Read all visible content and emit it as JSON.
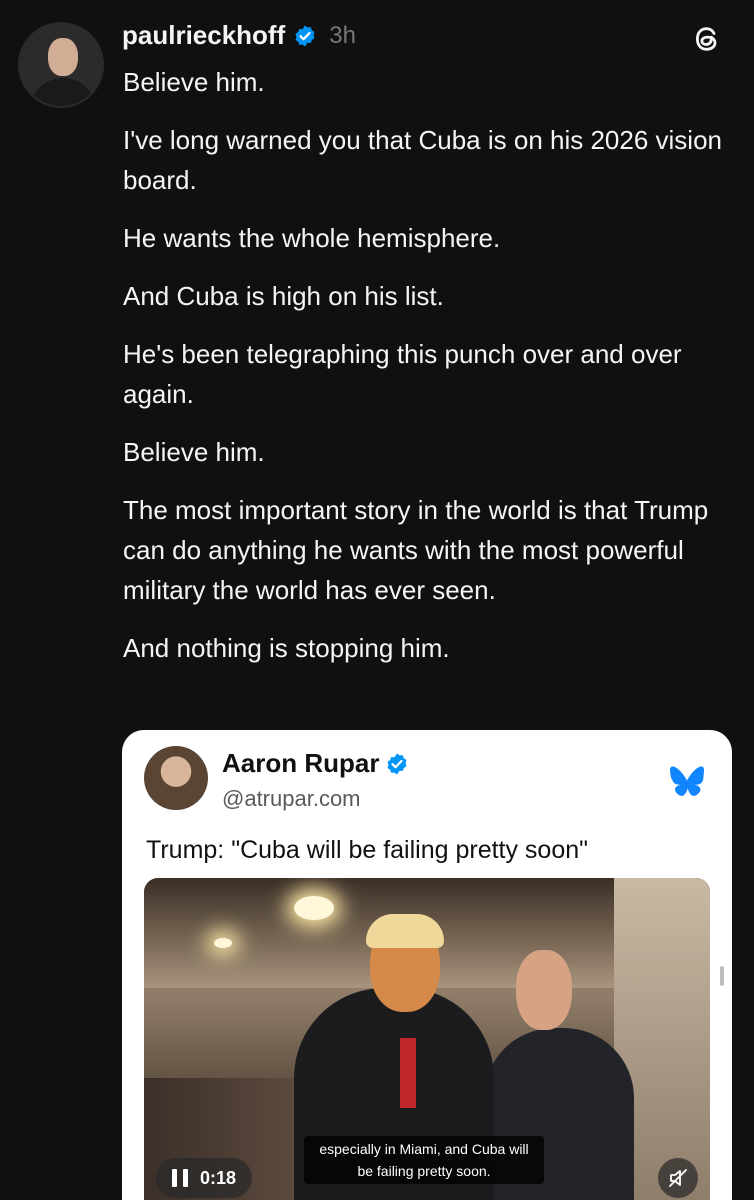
{
  "post": {
    "username": "paulrieckhoff",
    "timestamp": "3h",
    "paragraphs": [
      "Believe him.",
      "I've long warned you that Cuba is on his 2026 vision board.",
      "He wants the whole hemisphere.",
      "And Cuba is high on his list.",
      "He's been telegraphing this punch over and over again.",
      "Believe him.",
      "The most important story in the world is that Trump can do anything he wants with the most powerful military the world has ever seen.",
      "And nothing is stopping him."
    ],
    "icons": {
      "verified": "verified-badge-icon",
      "app": "threads-logo-icon"
    }
  },
  "embed": {
    "name": "Aaron Rupar",
    "handle": "@atrupar.com",
    "text": "Trump: \"Cuba will be failing pretty soon\"",
    "platform_icon": "bluesky-butterfly-icon",
    "video": {
      "caption_line1": "especially in Miami, and Cuba will",
      "caption_line2": "be failing pretty soon.",
      "duration": "0:18",
      "state": "playing",
      "muted": true
    }
  },
  "colors": {
    "background": "#101010",
    "text": "#f3f5f7",
    "muted_text": "#777777",
    "verified_blue": "#0095f6",
    "bluesky_blue": "#1185fe"
  }
}
